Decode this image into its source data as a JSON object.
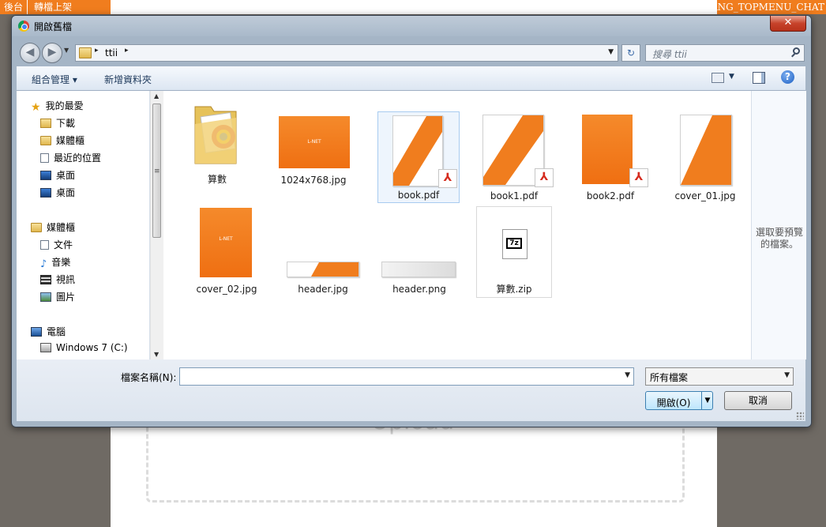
{
  "background": {
    "tabs": [
      "後台",
      "轉檔上架"
    ],
    "top_right": "LANG_TOPMENU_CHAT",
    "upload_text": "Upload"
  },
  "dialog": {
    "title": "開啟舊檔",
    "close_label": "✕",
    "address": {
      "crumb": "ttii"
    },
    "search_placeholder": "搜尋 ttii",
    "toolbar": {
      "organize": "組合管理 ▾",
      "new_folder": "新增資料夾"
    },
    "nav": {
      "favorites": "我的最愛",
      "downloads": "下載",
      "library": "媒體櫃",
      "recent": "最近的位置",
      "desktop1": "桌面",
      "desktop2": "桌面",
      "libraries": "媒體櫃",
      "documents": "文件",
      "music": "音樂",
      "videos": "視訊",
      "pictures": "圖片",
      "computer": "電腦",
      "drive_c": "Windows 7 (C:)"
    },
    "files": [
      {
        "name": "算數",
        "kind": "folder"
      },
      {
        "name": "1024x768.jpg",
        "kind": "image"
      },
      {
        "name": "book.pdf",
        "kind": "pdf",
        "selected": true
      },
      {
        "name": "book1.pdf",
        "kind": "pdf"
      },
      {
        "name": "book2.pdf",
        "kind": "pdf"
      },
      {
        "name": "cover_01.jpg",
        "kind": "image"
      },
      {
        "name": "cover_02.jpg",
        "kind": "image"
      },
      {
        "name": "header.jpg",
        "kind": "image"
      },
      {
        "name": "header.png",
        "kind": "image"
      },
      {
        "name": "算數.zip",
        "kind": "archive"
      }
    ],
    "thumb_brand": "L-NET",
    "preview_text": "選取要預覽的檔案。",
    "filename_label": "檔案名稱(N):",
    "filename_value": "",
    "filetype": "所有檔案",
    "open_label": "開啟(O)",
    "cancel_label": "取消"
  },
  "colors": {
    "accent": "#f07d1e",
    "selection": "#eef5fd"
  }
}
